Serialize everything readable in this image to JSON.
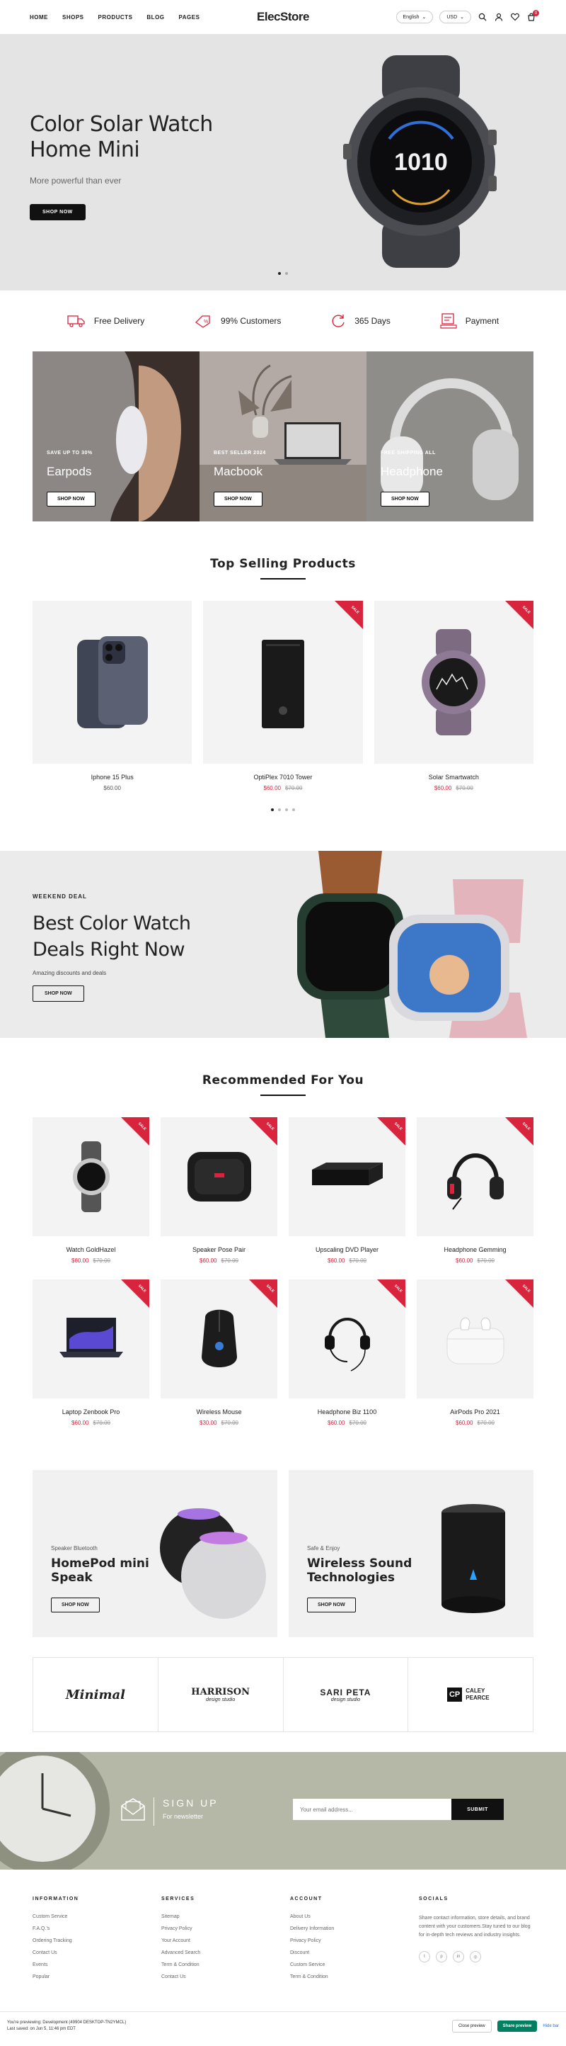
{
  "header": {
    "nav": [
      "HOME",
      "SHOPS",
      "PRODUCTS",
      "BLOG",
      "PAGES"
    ],
    "logo": "ElecStore",
    "language": "English",
    "currency": "USD",
    "cart_count": "0",
    "icons": [
      "search-icon",
      "user-icon",
      "heart-icon",
      "cart-icon"
    ]
  },
  "hero": {
    "title_line1": "Color Solar Watch",
    "title_line2": "Home Mini",
    "subtitle": "More powerful than ever",
    "button": "SHOP NOW",
    "watch_text": "1010",
    "slides": 2,
    "active_slide": 0
  },
  "features": [
    {
      "icon": "truck-icon",
      "label": "Free Delivery"
    },
    {
      "icon": "percent-icon",
      "label": "99% Customers"
    },
    {
      "icon": "refresh-icon",
      "label": "365 Days"
    },
    {
      "icon": "payment-icon",
      "label": "Payment"
    }
  ],
  "categories": [
    {
      "tag": "SAVE UP TO 30%",
      "name": "Earpods",
      "button": "SHOP NOW"
    },
    {
      "tag": "BEST SELLER 2024",
      "name": "Macbook",
      "button": "SHOP NOW"
    },
    {
      "tag": "FREE SHIPPING ALL",
      "name": "Headphone",
      "button": "SHOP NOW"
    }
  ],
  "top_selling": {
    "title": "Top Selling Products",
    "products": [
      {
        "name": "Iphone 15 Plus",
        "price": "$60.00",
        "old_price": "",
        "sale": false
      },
      {
        "name": "OptiPlex 7010 Tower",
        "price": "$60.00",
        "old_price": "$70.00",
        "sale": true
      },
      {
        "name": "Solar Smartwatch",
        "price": "$60.00",
        "old_price": "$70.00",
        "sale": true
      }
    ],
    "sale_label": "SALE",
    "pages": 4
  },
  "deal": {
    "kicker": "WEEKEND DEAL",
    "title_line1": "Best Color Watch",
    "title_line2": "Deals Right Now",
    "subtitle": "Amazing discounts and deals",
    "button": "SHOP NOW"
  },
  "recommended": {
    "title": "Recommended For You",
    "products": [
      {
        "name": "Watch GoldHazel",
        "price": "$60.00",
        "old_price": "$70.00"
      },
      {
        "name": "Speaker Pose Pair",
        "price": "$60.00",
        "old_price": "$70.00"
      },
      {
        "name": "Upscaling DVD Player",
        "price": "$60.00",
        "old_price": "$70.00"
      },
      {
        "name": "Headphone Gemming",
        "price": "$60.00",
        "old_price": "$70.00"
      },
      {
        "name": "Laptop Zenbook Pro",
        "price": "$60.00",
        "old_price": "$70.00"
      },
      {
        "name": "Wireless Mouse",
        "price": "$30.00",
        "old_price": "$70.00"
      },
      {
        "name": "Headphone Biz 1100",
        "price": "$60.00",
        "old_price": "$70.00"
      },
      {
        "name": "AirPods Pro 2021",
        "price": "$60.00",
        "old_price": "$70.00"
      }
    ]
  },
  "promos": [
    {
      "kicker": "Speaker Bluetooth",
      "title_line1": "HomePod mini",
      "title_line2": "Speak",
      "button": "SHOP NOW"
    },
    {
      "kicker": "Safe & Enjoy",
      "title_line1": "Wireless Sound",
      "title_line2": "Technologies",
      "button": "SHOP NOW"
    }
  ],
  "brands": [
    {
      "line1": "Minimal",
      "line2": ""
    },
    {
      "line1": "HARRISON",
      "line2": "design studio"
    },
    {
      "line1": "SARI PETA",
      "line2": "design studio"
    },
    {
      "line1": "CP",
      "line2": "CALEY PEARCE"
    }
  ],
  "newsletter": {
    "title": "SIGN UP",
    "subtitle": "For newsletter",
    "placeholder": "Your email address...",
    "button": "SUBMIT"
  },
  "footer": {
    "information": {
      "title": "INFORMATION",
      "links": [
        "Custom Service",
        "F.A.Q.'s",
        "Ordering Tracking",
        "Contact Us",
        "Events",
        "Popular"
      ]
    },
    "services": {
      "title": "SERVICES",
      "links": [
        "Sitemap",
        "Privacy Policy",
        "Your Account",
        "Advanced Search",
        "Term & Condition",
        "Contact Us"
      ]
    },
    "account": {
      "title": "ACCOUNT",
      "links": [
        "About Us",
        "Delivery Information",
        "Privacy Policy",
        "Discount",
        "Custom Service",
        "Term & Condition"
      ]
    },
    "socials": {
      "title": "SOCIALS",
      "text": "Share contact information, store details, and brand content with your customers.Stay tuned to our blog for in-depth tech reviews and industry insights.",
      "icons": [
        "twitter-icon",
        "pinterest-icon",
        "linkedin-icon",
        "instagram-icon"
      ]
    }
  },
  "preview_bar": {
    "line1": "You're previewing: Development (49904 DESKTOP-TN2YMCL)",
    "line2": "Last saved: on Jun 5, 11:46 pm EDT",
    "close": "Close preview",
    "share": "Share preview",
    "hide": "Hide bar"
  },
  "colors": {
    "accent": "#d9243d",
    "dark": "#111111",
    "hero_bg": "#e4e4e4",
    "news_bg": "#b5b8a6"
  }
}
